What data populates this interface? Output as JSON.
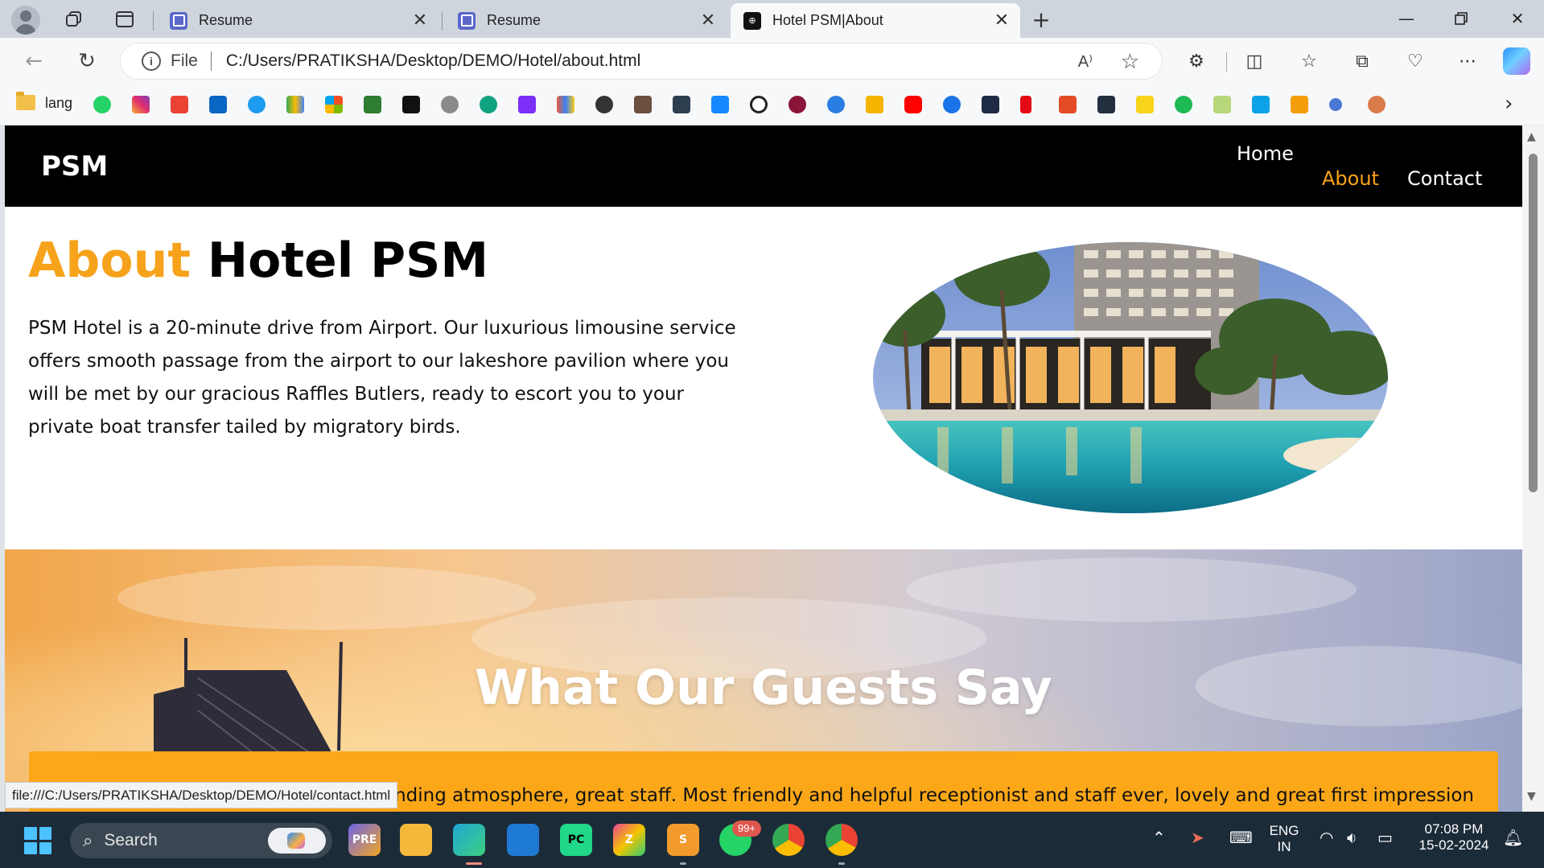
{
  "browser": {
    "tabs": [
      {
        "title": "Resume",
        "favicon": "document-icon",
        "active": false
      },
      {
        "title": "Resume",
        "favicon": "document-icon",
        "active": false
      },
      {
        "title": "Hotel PSM|About",
        "favicon": "hotel-icon",
        "active": true
      }
    ],
    "address": {
      "scheme": "File",
      "url": "C:/Users/PRATIKSHA/Desktop/DEMO/Hotel/about.html"
    },
    "bookmarks_folder": "lang",
    "bookmark_icons": [
      "whatsapp-icon",
      "instagram-icon",
      "gmail-icon",
      "linkedin-icon",
      "twitter-icon",
      "drive-icon",
      "microsoft-icon",
      "wordpress-icon",
      "hashnode-icon",
      "github-icon",
      "chatgpt-icon",
      "picsart-icon",
      "charts-icon",
      "codepen-icon",
      "codechef-icon",
      "hashnode-h-icon",
      "stackblitz-icon",
      "notion-icon",
      "vivaldi-icon",
      "bing-icon",
      "photos-icon",
      "youtube-icon",
      "play-icon",
      "dh-icon",
      "netflix-icon",
      "kaggle-icon",
      "amazon-icon",
      "flipkart-icon",
      "spotify-icon",
      "zee-icon",
      "is-icon",
      "trophy-icon",
      "search-icon",
      "emblem-icon"
    ],
    "status_url": "file:///C:/Users/PRATIKSHA/Desktop/DEMO/Hotel/contact.html"
  },
  "site": {
    "logo": "PSM",
    "nav": {
      "home": "Home",
      "about": "About",
      "contact": "Contact"
    },
    "about": {
      "title_accent": "About",
      "title_rest": "Hotel PSM",
      "body": "PSM Hotel is a 20-minute drive from Airport. Our luxurious limousine service offers smooth passage from the airport to our lakeshore pavilion where you will be met by our gracious Raffles Butlers, ready to escort you to your private boat transfer tailed by migratory birds."
    },
    "guests": {
      "title": "What Our Guests Say",
      "review_visible": "l surrounding atmosphere, great staff. Most friendly and helpful receptionist and staff ever, lovely and great first impression"
    },
    "colors": {
      "accent": "#f7a21b",
      "nav_bg": "#000000",
      "review_card": "#fba718"
    }
  },
  "taskbar": {
    "search_label": "Search",
    "whatsapp_badge": "99+",
    "lang_top": "ENG",
    "lang_bottom": "IN",
    "time": "07:08 PM",
    "date": "15-02-2024"
  }
}
